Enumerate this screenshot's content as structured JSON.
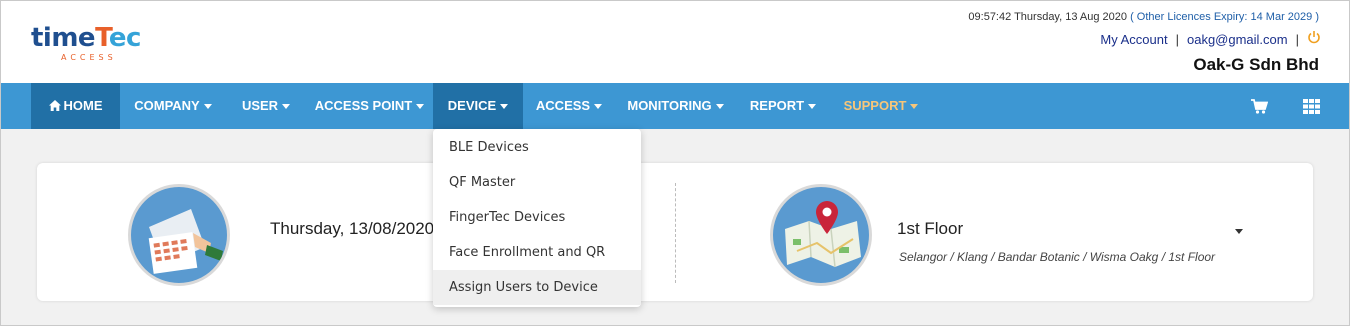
{
  "header": {
    "logo": {
      "word1": "time",
      "word2": "T",
      "word3": "ec",
      "sub": "ACCESS"
    },
    "datetime": "09:57:42 Thursday, 13 Aug 2020",
    "licence_text": "( Other Licences Expiry:  14 Mar 2029 )",
    "my_account": "My Account",
    "separator": "|",
    "email": "oakg@gmail.com",
    "power_icon": "power-icon",
    "company": "Oak-G Sdn Bhd"
  },
  "nav": {
    "items": [
      {
        "label": "HOME",
        "icon": "home-icon"
      },
      {
        "label": "COMPANY"
      },
      {
        "label": "USER"
      },
      {
        "label": "ACCESS POINT"
      },
      {
        "label": "DEVICE"
      },
      {
        "label": "ACCESS"
      },
      {
        "label": "MONITORING"
      },
      {
        "label": "REPORT"
      },
      {
        "label": "SUPPORT"
      }
    ],
    "active": "DEVICE",
    "cart_icon": "cart-icon",
    "apps_icon": "apps-grid-icon"
  },
  "dropdown": {
    "items": [
      "BLE Devices",
      "QF Master",
      "FingerTec Devices",
      "Face Enrollment and QR Code",
      "Assign Users to Device"
    ],
    "highlighted": "Assign Users to Device"
  },
  "dashboard": {
    "date": "Thursday, 13/08/2020",
    "floor": "1st Floor",
    "location_path": "Selangor / Klang / Bandar Botanic / Wisma Oakg / 1st Floor"
  },
  "colors": {
    "nav_bg": "#3d97d3",
    "nav_active": "#2170a6",
    "support_text": "#f7c67a",
    "brand_orange": "#e8602a",
    "brand_navy": "#1f4f8f",
    "link": "#1a2f8a"
  }
}
